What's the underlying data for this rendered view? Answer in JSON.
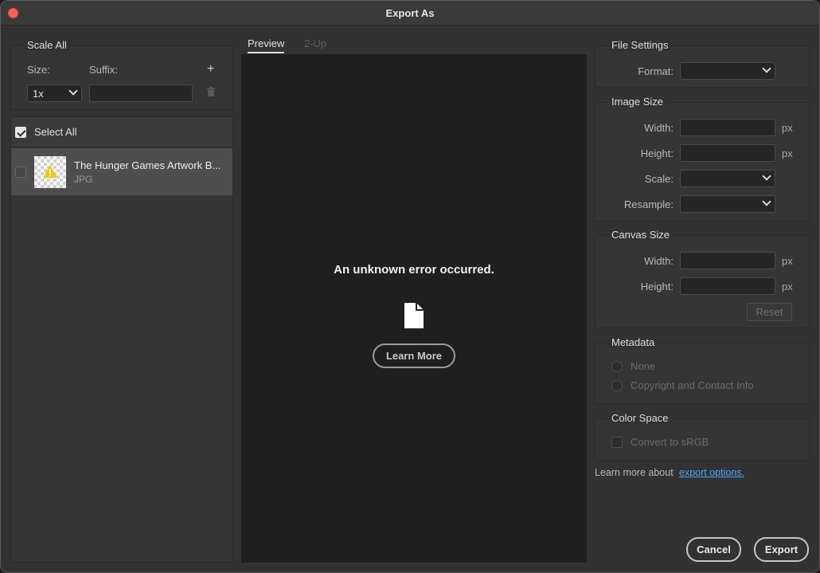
{
  "window": {
    "title": "Export As"
  },
  "scale_all": {
    "title": "Scale All",
    "size_label": "Size:",
    "suffix_label": "Suffix:",
    "size_value": "1x",
    "suffix_value": "",
    "add_symbol": "+",
    "trash_icon": "trash-icon"
  },
  "assets": {
    "select_all_label": "Select All",
    "select_all_checked": true,
    "items": [
      {
        "name": "The Hunger Games Artwork B...",
        "type": "JPG",
        "checked": false,
        "warning_icon": "warning-icon"
      }
    ]
  },
  "preview": {
    "tabs": [
      {
        "label": "Preview",
        "active": true
      },
      {
        "label": "2-Up",
        "active": false
      }
    ],
    "error_message": "An unknown error occurred.",
    "file_icon": "document-icon",
    "learn_more_label": "Learn More"
  },
  "file_settings": {
    "title": "File Settings",
    "format_label": "Format:",
    "format_value": ""
  },
  "image_size": {
    "title": "Image Size",
    "width_label": "Width:",
    "height_label": "Height:",
    "scale_label": "Scale:",
    "resample_label": "Resample:",
    "unit": "px"
  },
  "canvas_size": {
    "title": "Canvas Size",
    "width_label": "Width:",
    "height_label": "Height:",
    "unit": "px",
    "reset_label": "Reset"
  },
  "metadata": {
    "title": "Metadata",
    "options": [
      "None",
      "Copyright and Contact Info"
    ]
  },
  "color_space": {
    "title": "Color Space",
    "convert_label": "Convert to sRGB"
  },
  "footer": {
    "learn_more_text": "Learn more about",
    "link_text": "export options.",
    "cancel_label": "Cancel",
    "export_label": "Export"
  },
  "colors": {
    "accent_link": "#4da3ff",
    "close_button": "#fe5f57",
    "warning": "#f0c800"
  }
}
